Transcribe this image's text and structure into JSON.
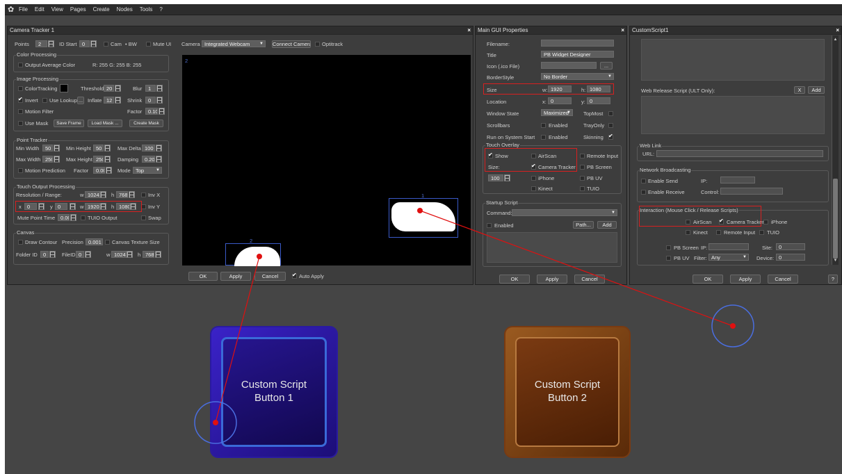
{
  "menu": {
    "items": [
      "File",
      "Edit",
      "View",
      "Pages",
      "Create",
      "Nodes",
      "Tools",
      "?"
    ]
  },
  "camera_tracker": {
    "title": "Camera Tracker 1",
    "points_label": "Points",
    "points_value": "2",
    "id_start_label": "ID Start",
    "id_start_value": "0",
    "cam_label": "Cam",
    "bw_label": "BW",
    "mute_ui_label": "Mute UI",
    "camera_label": "Camera",
    "camera_value": "Integrated Webcam",
    "connect_camera": "Connect Camera",
    "optitrack": "Optitrack",
    "color_processing": {
      "label": "Color Processing",
      "output_avg": "Output Average Color",
      "rgb": "R: 255  G: 255  B: 255"
    },
    "image_processing": {
      "label": "Image Processing",
      "color_tracking": "ColorTracking",
      "threshold": "Threshold",
      "threshold_value": "20",
      "blur": "Blur",
      "blur_value": "1",
      "invert": "Invert",
      "use_lookup": "Use Lookup",
      "lookup_btn": "...",
      "inflate": "Inflate",
      "inflate_value": "12",
      "shrink": "Shrink",
      "shrink_value": "0",
      "motion_filter": "Motion Filter",
      "factor": "Factor",
      "factor_value": "0.10",
      "use_mask": "Use Mask",
      "save_frame": "Save Frame",
      "load_mask": "Load Mask ...",
      "create_mask": "Create Mask"
    },
    "point_tracker": {
      "label": "Point Tracker",
      "min_width": "Min Width",
      "min_width_value": "50",
      "min_height": "Min Height",
      "min_height_value": "50",
      "max_delta": "Max Delta",
      "max_delta_value": "100",
      "max_width": "Max Width",
      "max_width_value": "250",
      "max_height": "Max Height",
      "max_height_value": "250",
      "damping": "Damping",
      "damping_value": "0.20",
      "motion_prediction": "Motion Prediction",
      "factor": "Factor",
      "factor_value": "0.00",
      "mode": "Mode",
      "mode_value": "Top"
    },
    "touch_output": {
      "label": "Touch Output Processing",
      "res_range": "Resolution / Range:",
      "w": "w",
      "w_value": "1024",
      "h": "h",
      "h_value": "768",
      "invx": "Inv X",
      "x": "x",
      "x_value": "0",
      "y": "y",
      "y_value": "0",
      "w2_value": "1920",
      "h2_value": "1080",
      "invy": "Inv Y",
      "mute_point_time": "Mute Point Time",
      "mute_point_value": "0.00",
      "tuio_output": "TUIO Output",
      "swap": "Swap"
    },
    "canvas": {
      "label": "Canvas",
      "draw_contour": "Draw Contour",
      "precision": "Precision",
      "precision_value": "0.001",
      "canvas_texture": "Canvas Texture Size",
      "folder_id": "Folder ID",
      "folder_value": "0",
      "file_id": "FileID",
      "file_value": "0",
      "w": "w",
      "w_value": "1024",
      "h": "h",
      "h_value": "768"
    },
    "preview": {
      "id1": "2",
      "id_blob1": "1",
      "id_blob2": "2"
    },
    "ok": "OK",
    "apply": "Apply",
    "cancel": "Cancel",
    "auto_apply": "Auto Apply"
  },
  "main_gui": {
    "title": "Main GUI Properties",
    "filename": "Filename:",
    "filename_value": "",
    "title_label": "Title",
    "title_value": "PB Widget Designer",
    "icon_label": "Icon (.ico File)",
    "icon_btn": "...",
    "border_label": "BorderStyle",
    "border_value": "No Border",
    "size_label": "Size",
    "w": "w:",
    "w_value": "1920",
    "h": "h:",
    "h_value": "1080",
    "location_label": "Location",
    "x": "x:",
    "x_value": "0",
    "y": "y:",
    "y_value": "0",
    "window_state": "Window State",
    "window_state_value": "Maximized",
    "topmost": "TopMost",
    "scrollbars": "Scrollbars",
    "enabled": "Enabled",
    "trayonly": "TrayOnly",
    "run_on_start": "Run on System Start",
    "skinning": "Skinning",
    "touch_overlay": {
      "label": "Touch Overlay",
      "show": "Show",
      "airscan": "AirScan",
      "remote_input": "Remote Input",
      "size": "Size:",
      "camera_tracker": "Camera Tracker",
      "pb_screen": "PB Screen",
      "size_value": "100",
      "iphone": "iPhone",
      "pb_uv": "PB UV",
      "kinect": "Kinect",
      "tuio": "TUIO"
    },
    "startup": {
      "label": "Startup Script",
      "command": "Command:",
      "enabled": "Enabled",
      "path": "Path...",
      "add": "Add"
    },
    "ok": "OK",
    "apply": "Apply",
    "cancel": "Cancel"
  },
  "custom_script": {
    "title": "CustomScript1",
    "web_release": "Web Release Script (ULT Only):",
    "x_btn": "X",
    "add": "Add",
    "web_link": {
      "label": "Web Link",
      "url": "URL:"
    },
    "network": {
      "label": "Network Broadcasting",
      "enable_send": "Enable Send",
      "ip": "IP:",
      "enable_receive": "Enable Receive",
      "control": "Control:"
    },
    "interaction": {
      "label": "Interaction (Mouse Click / Release Scripts)",
      "airscan": "AirScan",
      "camera_tracker": "Camera Tracker",
      "iphone": "iPhone",
      "kinect": "Kinect",
      "remote_input": "Remote Input",
      "tuio": "TUIO",
      "pb_screen": "PB Screen",
      "ip": "IP:",
      "site": "Site:",
      "site_value": "0",
      "pb_uv": "PB UV",
      "filter": "Filter:",
      "filter_value": "Any",
      "device": "Device:",
      "device_value": "0"
    },
    "ok": "OK",
    "apply": "Apply",
    "cancel": "Cancel",
    "help": "?"
  },
  "canvas_buttons": {
    "btn1": "Custom Script Button 1",
    "btn1_l1": "Custom Script",
    "btn1_l2": "Button 1",
    "btn2_l1": "Custom Script",
    "btn2_l2": "Button 2"
  },
  "colors": {
    "bg": "#454545",
    "panel": "#3d3d3d",
    "highlight": "#d82020",
    "touch_circle": "#4a6ee0",
    "touch_dot": "#e01010",
    "btn1": "#2a1aa0",
    "btn2": "#7a3a10"
  }
}
